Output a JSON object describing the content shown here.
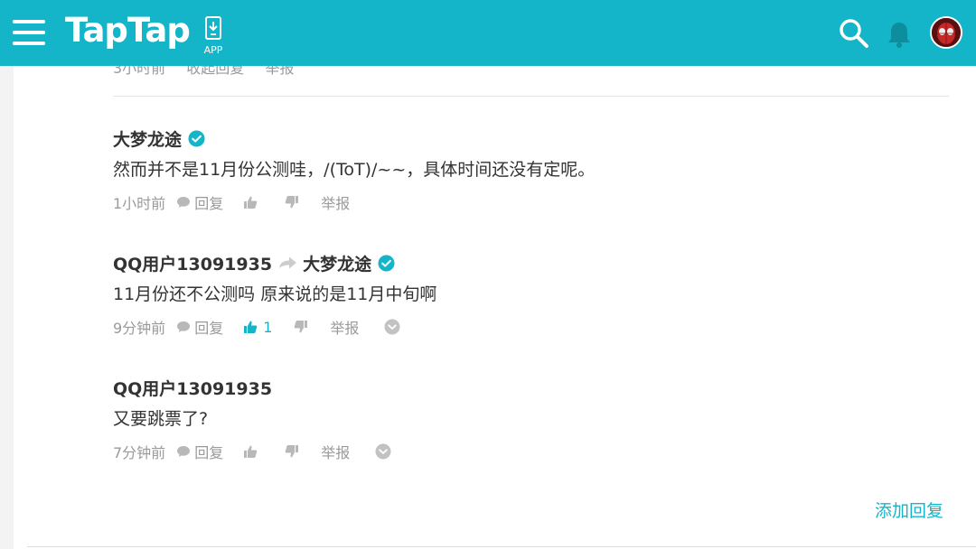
{
  "header": {
    "logo_text": "TapTap",
    "app_label": "APP",
    "accent_color": "#15b5c9"
  },
  "previous_comment": {
    "time": "3小时前",
    "collapse_label": "收起回复",
    "report_label": "举报"
  },
  "comments": [
    {
      "author": "大梦龙途",
      "verified": true,
      "text": "然而并不是11月份公测哇，/(ToT)/~~，具体时间还没有定呢。",
      "time": "1小时前",
      "reply_label": "回复",
      "likes": "",
      "report_label": "举报"
    },
    {
      "author": "QQ用户13091935",
      "reply_to": "大梦龙途",
      "reply_to_verified": true,
      "text": "11月份还不公测吗 原来说的是11月中旬啊",
      "time": "9分钟前",
      "reply_label": "回复",
      "likes": "1",
      "report_label": "举报"
    },
    {
      "author": "QQ用户13091935",
      "text": "又要跳票了?",
      "time": "7分钟前",
      "reply_label": "回复",
      "likes": "",
      "report_label": "举报"
    }
  ],
  "add_reply_label": "添加回复",
  "icons": {
    "menu": "hamburger-menu-icon",
    "app": "phone-download-icon",
    "search": "search-icon",
    "bell": "bell-icon",
    "verified": "verified-check-icon",
    "reply": "speech-bubble-icon",
    "like": "thumbs-up-icon",
    "dislike": "thumbs-down-icon",
    "expand": "chevron-down-circle-icon",
    "reply_arrow": "reply-arrow-icon"
  }
}
